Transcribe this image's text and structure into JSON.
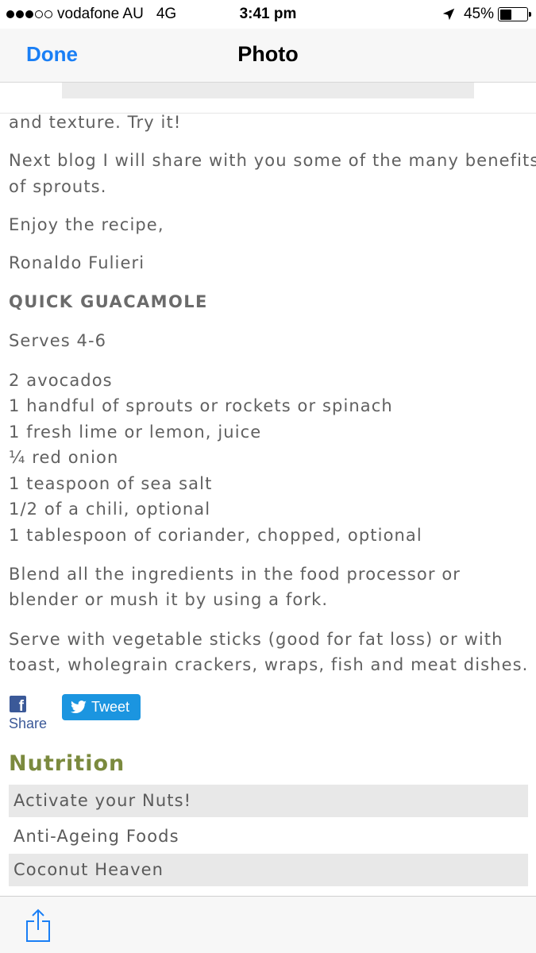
{
  "status_bar": {
    "carrier": "vodafone AU",
    "network": "4G",
    "time": "3:41 pm",
    "battery_percent_label": "45%",
    "battery_level": 0.45,
    "signal_bars_filled": 3,
    "signal_bars_total": 5
  },
  "nav": {
    "done_label": "Done",
    "title": "Photo",
    "accent_color": "#1a7ff5"
  },
  "article": {
    "lines": [
      "and texture. Try it!",
      "Next blog I will share with you some of the many benefits",
      "of sprouts.",
      "Enjoy the recipe,",
      "Ronaldo Fulieri",
      "QUICK GUACAMOLE",
      "Serves 4-6",
      "2 avocados",
      "1 handful of sprouts or rockets or spinach",
      "1 fresh lime or lemon, juice",
      "¼ red onion",
      "1 teaspoon of sea salt",
      "1/2 of a chili, optional",
      "1 tablespoon of coriander, chopped, optional",
      "Blend all the ingredients in the food processor or",
      "blender or mush it by using a fork.",
      "Serve with vegetable sticks (good for fat loss) or with",
      "toast, wholegrain crackers, wraps, fish and meat dishes."
    ]
  },
  "social": {
    "facebook_label": "Share",
    "tweet_label": "Tweet",
    "facebook_color": "#3b5998",
    "twitter_color": "#1b95e0"
  },
  "sidebar": {
    "title": "Nutrition",
    "title_color": "#7b8a3e",
    "items": [
      "Activate your Nuts!",
      "Anti-Ageing Foods",
      "Coconut Heaven"
    ]
  },
  "toolbar": {
    "share_icon": "share-icon"
  }
}
